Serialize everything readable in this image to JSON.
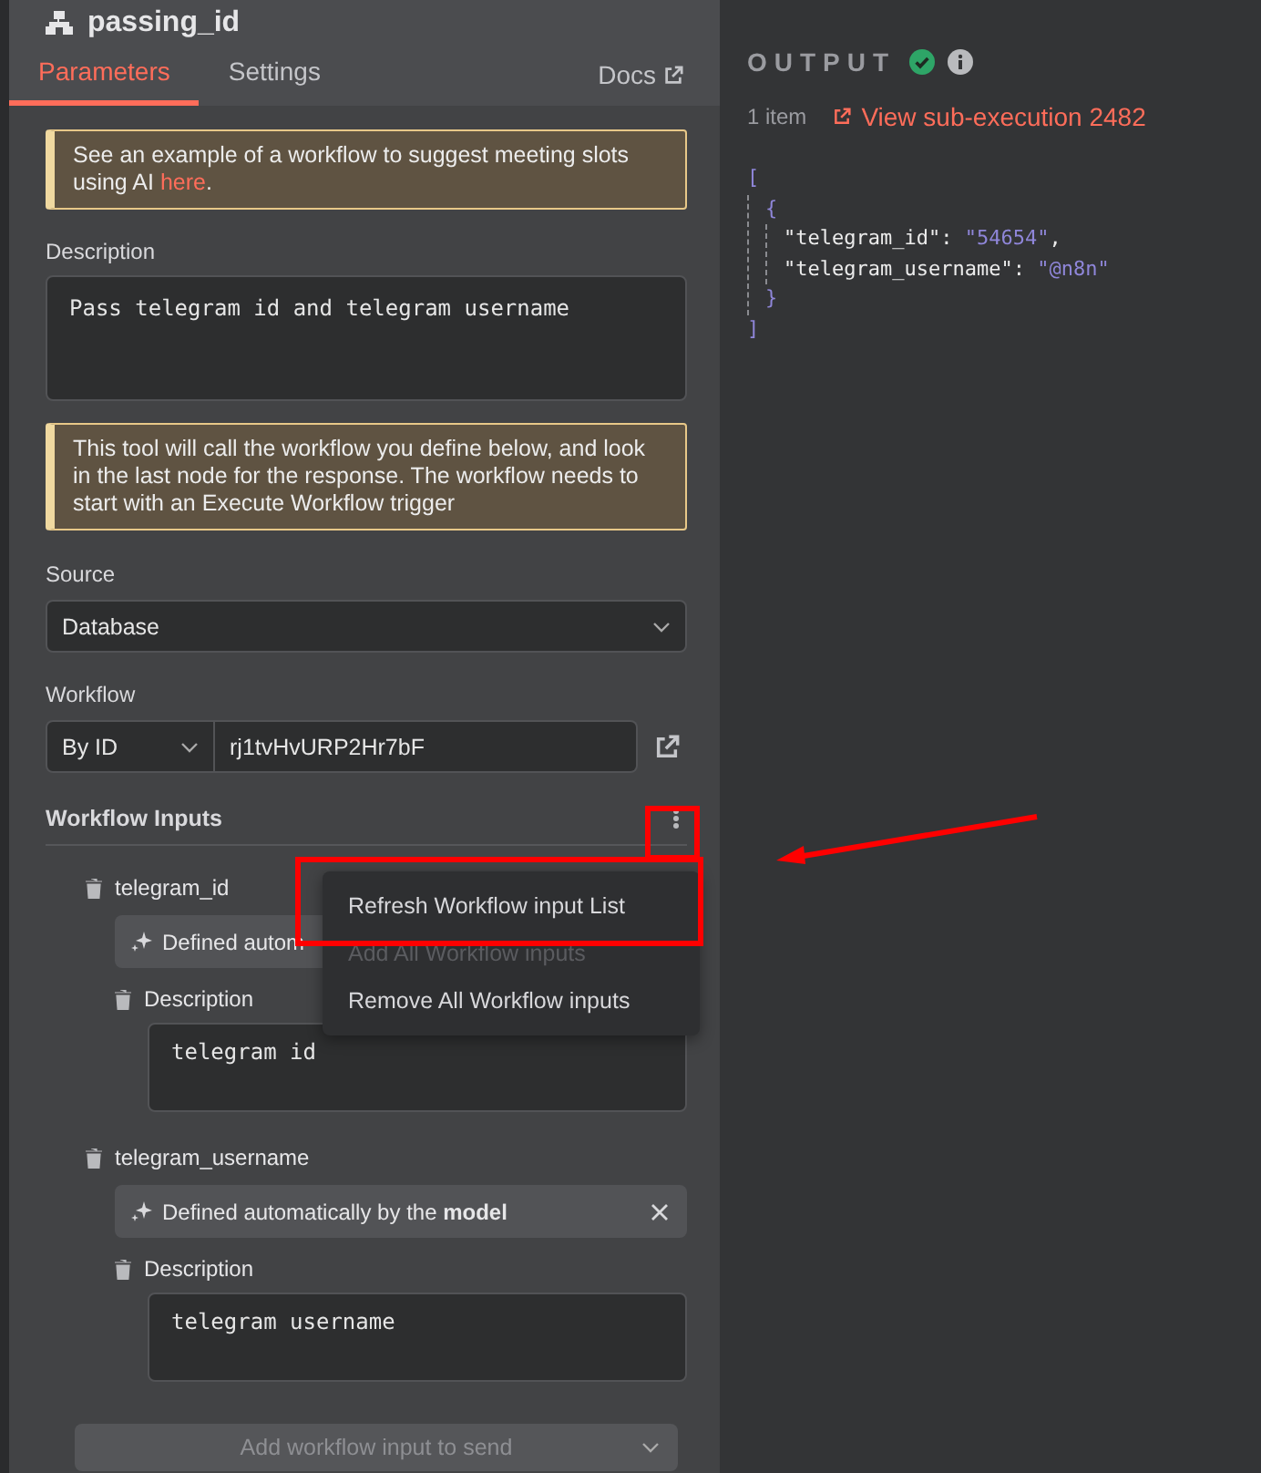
{
  "node": {
    "title": "passing_id"
  },
  "tabs": [
    {
      "label": "Parameters",
      "selected": true
    },
    {
      "label": "Settings",
      "selected": false
    }
  ],
  "docs_link": "Docs",
  "notice": {
    "text": "See an example of a workflow to suggest meeting slots using AI ",
    "link": "here",
    "after": "."
  },
  "description": {
    "label": "Description",
    "value": "Pass telegram id and telegram username"
  },
  "info_callout": "This tool will call the workflow you define below, and look in the last node for the response. The workflow needs to start with an Execute Workflow trigger",
  "source": {
    "label": "Source",
    "value": "Database"
  },
  "workflow": {
    "label": "Workflow",
    "mode": "By ID",
    "value": "rj1tvHvURP2Hr7bF"
  },
  "workflow_inputs": {
    "label": "Workflow Inputs",
    "items": [
      {
        "name": "telegram_id",
        "chip": "Defined autom",
        "description_label": "Description",
        "description": "telegram id"
      },
      {
        "name": "telegram_username",
        "chip": "Defined automatically by the **model**",
        "removable": true,
        "description_label": "Description",
        "description": "telegram username"
      }
    ],
    "add_button": "Add workflow input to send"
  },
  "menu": {
    "items": [
      {
        "label": "Refresh Workflow input List",
        "disabled": false
      },
      {
        "label": "Add All Workflow inputs",
        "disabled": true
      },
      {
        "label": "Remove All Workflow inputs",
        "disabled": false
      }
    ]
  },
  "output": {
    "title": "OUTPUT",
    "item_count": "1 item",
    "link": "View sub-execution 2482",
    "json": {
      "open": "[",
      "close": "]",
      "children": [
        {
          "open": "{",
          "close": "}",
          "fields": [
            {
              "key": "\"telegram_id\":",
              "value": "\"54654\"",
              "separator": ","
            },
            {
              "key": "\"telegram_username\":",
              "value": "\"@n8n\""
            }
          ]
        }
      ]
    }
  }
}
